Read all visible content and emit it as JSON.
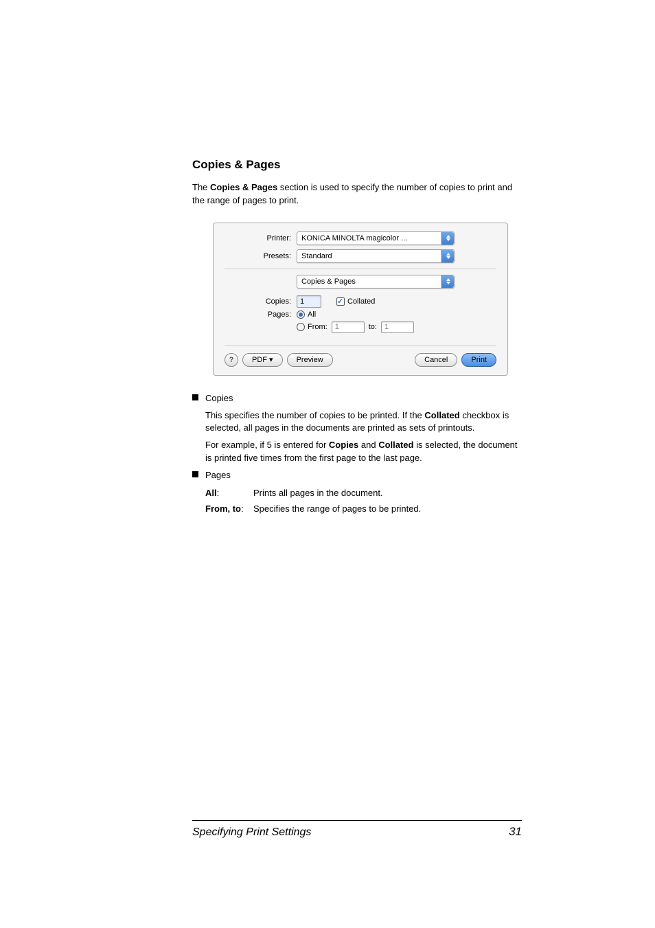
{
  "heading": "Copies & Pages",
  "intro_part1": "The ",
  "intro_bold": "Copies & Pages",
  "intro_part2": " section is used to specify the number of copies to print and the range of pages to print.",
  "dialog": {
    "printer_label": "Printer:",
    "printer_value": "KONICA MINOLTA magicolor ...",
    "presets_label": "Presets:",
    "presets_value": "Standard",
    "panel_value": "Copies & Pages",
    "copies_label": "Copies:",
    "copies_value": "1",
    "collated_label": "Collated",
    "pages_label": "Pages:",
    "pages_all": "All",
    "pages_from_label": "From:",
    "pages_from_value": "1",
    "pages_to_label": "to:",
    "pages_to_value": "1",
    "help_label": "?",
    "pdf_label": "PDF ▾",
    "preview_label": "Preview",
    "cancel_label": "Cancel",
    "print_label": "Print"
  },
  "bullets": {
    "copies_title": "Copies",
    "copies_text1a": "This specifies the number of copies to be printed. If the ",
    "copies_text1b": "Collated",
    "copies_text1c": " checkbox is selected, all pages in the documents are printed as sets of printouts.",
    "copies_text2a": "For example, if 5 is entered for ",
    "copies_text2b": "Copies",
    "copies_text2c": " and ",
    "copies_text2d": "Collated",
    "copies_text2e": " is selected, the document is printed five times from the first page to the last page.",
    "pages_title": "Pages",
    "all_term": "All",
    "all_colon": ":",
    "all_def": "Prints all pages in the document.",
    "from_term": "From, to",
    "from_colon": ":",
    "from_def": "Specifies the range of pages to be printed."
  },
  "footer": {
    "left": "Specifying Print Settings",
    "right": "31"
  }
}
